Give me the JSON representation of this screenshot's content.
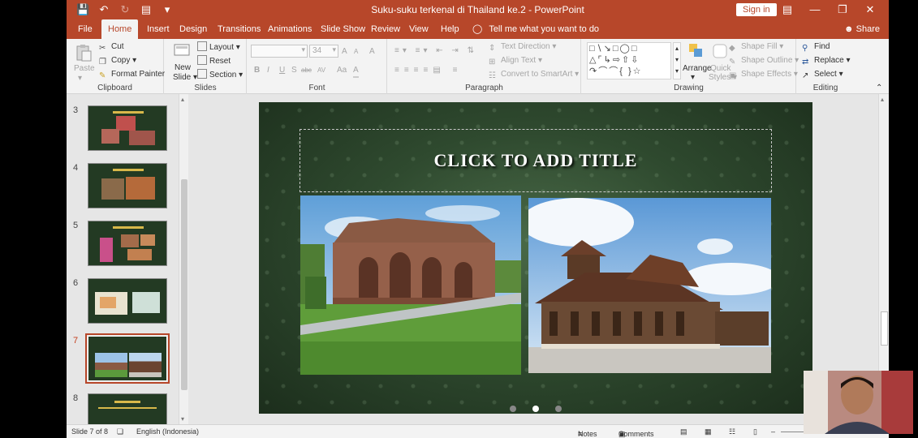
{
  "window": {
    "title": "Suku-suku terkenal di Thailand ke.2  -  PowerPoint",
    "sign_in": "Sign in",
    "colors": {
      "accent": "#b7472a",
      "ribbon_bg": "#f3f3f3"
    }
  },
  "tabs": [
    "File",
    "Home",
    "Insert",
    "Design",
    "Transitions",
    "Animations",
    "Slide Show",
    "Review",
    "View",
    "Help"
  ],
  "active_tab": "Home",
  "tell_me": "Tell me what you want to do",
  "share": "Share",
  "ribbon": {
    "clipboard": {
      "label": "Clipboard",
      "paste": "Paste",
      "cut": "Cut",
      "copy": "Copy",
      "format_painter": "Format Painter"
    },
    "slides": {
      "label": "Slides",
      "new_slide_1": "New",
      "new_slide_2": "Slide",
      "layout": "Layout",
      "reset": "Reset",
      "section": "Section"
    },
    "font": {
      "label": "Font",
      "size": "34",
      "bold": "B",
      "italic": "I",
      "underline": "U",
      "strike": "S",
      "shadow": "abc",
      "spacing": "AV",
      "case": "Aa",
      "grow": "A",
      "shrink": "A",
      "clear": "A",
      "color": "A"
    },
    "paragraph": {
      "label": "Paragraph",
      "text_direction": "Text Direction",
      "align_text": "Align Text",
      "smartart": "Convert to SmartArt"
    },
    "drawing": {
      "label": "Drawing",
      "arrange": "Arrange",
      "quick_styles_1": "Quick",
      "quick_styles_2": "Styles",
      "shape_fill": "Shape Fill",
      "shape_outline": "Shape Outline",
      "shape_effects": "Shape Effects"
    },
    "editing": {
      "label": "Editing",
      "find": "Find",
      "replace": "Replace",
      "select": "Select"
    }
  },
  "thumbnails": [
    {
      "num": "3",
      "selected": false
    },
    {
      "num": "4",
      "selected": false
    },
    {
      "num": "5",
      "selected": false
    },
    {
      "num": "6",
      "selected": false
    },
    {
      "num": "7",
      "selected": true
    },
    {
      "num": "8",
      "selected": false
    }
  ],
  "slide": {
    "title_placeholder": "CLICK TO ADD TITLE"
  },
  "status": {
    "slide_info": "Slide 7 of 8",
    "language": "English (Indonesia)",
    "notes": "Notes",
    "comments": "Comments"
  }
}
